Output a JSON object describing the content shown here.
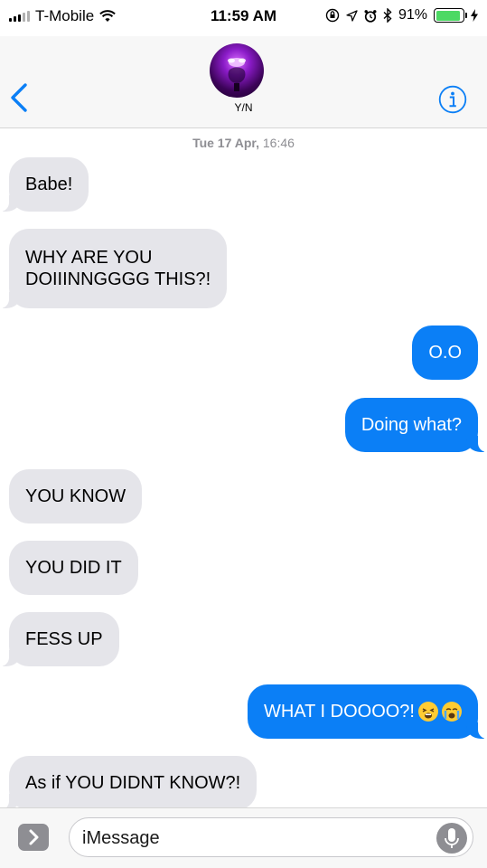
{
  "status_bar": {
    "carrier": "T-Mobile",
    "time": "11:59 AM",
    "battery_percent": "91%",
    "battery_level": 0.91,
    "icons": [
      "signal-icon",
      "wifi-icon",
      "orientation-lock-icon",
      "location-icon",
      "alarm-icon",
      "bluetooth-icon",
      "battery-icon",
      "charging-icon"
    ]
  },
  "header": {
    "contact_name": "Y/N",
    "back_icon": "chevron-left-icon",
    "info_icon": "info-icon",
    "accent_color": "#0b7ff6"
  },
  "conversation": {
    "timestamp_day": "Tue 17 Apr,",
    "timestamp_time": "16:46",
    "messages": [
      {
        "side": "received",
        "text": "Babe!"
      },
      {
        "side": "received",
        "text": "WHY ARE YOU\nDOIIINNGGGG THIS?!"
      },
      {
        "side": "sent",
        "text": "O.O"
      },
      {
        "side": "sent",
        "text": "Doing what?"
      },
      {
        "side": "received",
        "text": "YOU KNOW"
      },
      {
        "side": "received",
        "text": "YOU DID IT"
      },
      {
        "side": "received",
        "text": "FESS UP"
      },
      {
        "side": "sent",
        "text": "WHAT I DOOOO?!",
        "emojis": [
          "tired-face-emoji",
          "crying-face-emoji"
        ]
      },
      {
        "side": "received",
        "text": "As if YOU DIDNT KNOW?!"
      }
    ],
    "colors": {
      "sent_bubble": "#0b7ff6",
      "received_bubble": "#e5e5ea"
    }
  },
  "input": {
    "placeholder": "iMessage",
    "apps_icon": "chevron-right-icon",
    "mic_icon": "microphone-icon"
  }
}
